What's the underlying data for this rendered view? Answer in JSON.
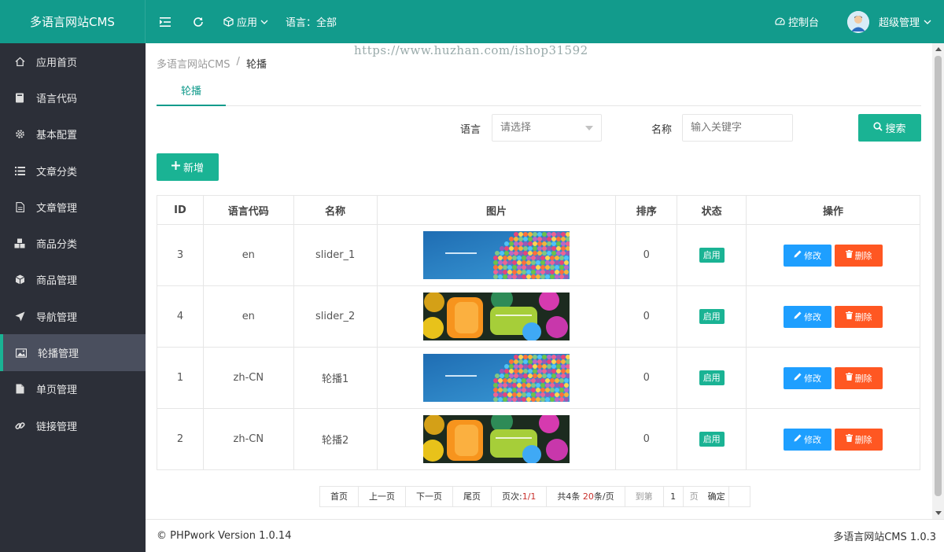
{
  "header": {
    "logo": "多语言网站CMS",
    "app_menu": "应用",
    "lang_label": "语言：全部",
    "dashboard": "控制台",
    "user": "超级管理"
  },
  "sidebar": {
    "items": [
      {
        "label": "应用首页",
        "icon": "home-icon"
      },
      {
        "label": "语言代码",
        "icon": "book-icon"
      },
      {
        "label": "基本配置",
        "icon": "gear-icon"
      },
      {
        "label": "文章分类",
        "icon": "list-icon"
      },
      {
        "label": "文章管理",
        "icon": "file-icon"
      },
      {
        "label": "商品分类",
        "icon": "cubes-icon"
      },
      {
        "label": "商品管理",
        "icon": "cube-icon"
      },
      {
        "label": "导航管理",
        "icon": "send-icon"
      },
      {
        "label": "轮播管理",
        "icon": "image-icon"
      },
      {
        "label": "单页管理",
        "icon": "page-icon"
      },
      {
        "label": "链接管理",
        "icon": "link-icon"
      }
    ],
    "active_index": 8
  },
  "watermark": "https://www.huzhan.com/ishop31592",
  "breadcrumb": {
    "root": "多语言网站CMS",
    "sep": "/",
    "current": "轮播"
  },
  "tab": "轮播",
  "filters": {
    "lang_label": "语言",
    "lang_placeholder": "请选择",
    "name_label": "名称",
    "name_placeholder": "输入关键字",
    "search_button": "搜索"
  },
  "add_button": "新增",
  "table": {
    "headers": [
      "ID",
      "语言代码",
      "名称",
      "图片",
      "排序",
      "状态",
      "操作"
    ],
    "rows": [
      {
        "id": "3",
        "lang": "en",
        "name": "slider_1",
        "image": "balloons",
        "sort": "0",
        "status": "启用"
      },
      {
        "id": "4",
        "lang": "en",
        "name": "slider_2",
        "image": "paint",
        "sort": "0",
        "status": "启用"
      },
      {
        "id": "1",
        "lang": "zh-CN",
        "name": "轮播1",
        "image": "balloons",
        "sort": "0",
        "status": "启用"
      },
      {
        "id": "2",
        "lang": "zh-CN",
        "name": "轮播2",
        "image": "paint",
        "sort": "0",
        "status": "启用"
      }
    ],
    "edit_label": "修改",
    "delete_label": "删除"
  },
  "pagination": {
    "first": "首页",
    "prev": "上一页",
    "next": "下一页",
    "last": "尾页",
    "page_info_prefix": "页次:",
    "page_info_value": "1/1",
    "total_prefix": "共4条 ",
    "per_page_value": "20",
    "per_page_suffix": "条/页",
    "goto_label": "到第",
    "goto_value": "1",
    "page_suffix": "页",
    "confirm": "确定"
  },
  "footer": {
    "left": "© PHPwork Version 1.0.14",
    "right": "多语言网站CMS 1.0.3"
  },
  "colors": {
    "primary": "#129b8c",
    "accent": "#1ab394",
    "sidebar": "#2c2f38",
    "edit": "#1e9fff",
    "delete": "#ff5722"
  }
}
